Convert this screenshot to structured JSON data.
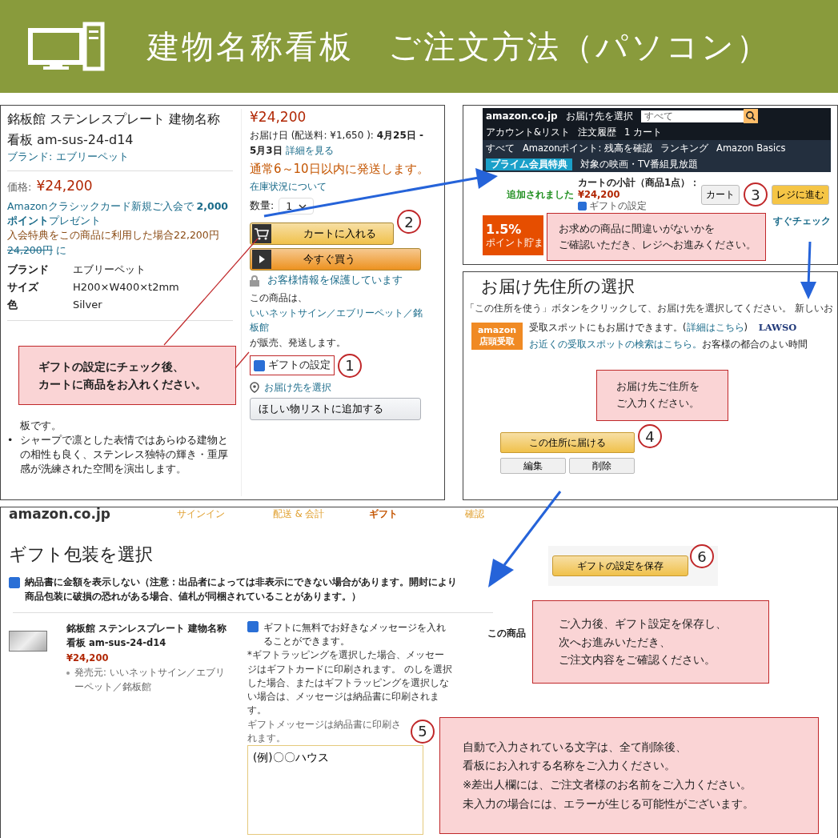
{
  "header": {
    "title": "建物名称看板　ご注文方法（パソコン）"
  },
  "product_panel": {
    "title": "銘板館 ステンレスプレート 建物名称看板 am-sus-24-d14",
    "brand_link": "ブランド: エブリーペット",
    "price_label": "価格:",
    "price": "¥24,200",
    "promo_line": "Amazonクラシックカード新規ご入会で **2,000ポイント**プレゼント",
    "promo_benefit": "入会特典をこの商品に利用した場合22,200円",
    "promo_old_price": "24,200円",
    "promo_suffix": "に",
    "specs": [
      {
        "label": "ブランド",
        "value": "エブリーペット"
      },
      {
        "label": "サイズ",
        "value": "H200×W400×t2mm"
      },
      {
        "label": "色",
        "value": "Silver"
      }
    ],
    "bullets": [
      {
        "kind": "continuation",
        "text": "板です。"
      },
      {
        "kind": "bullet",
        "marker": "•",
        "text": "シャープで凛とした表情ではあらゆる建物との相性も良く、ステンレス独特の輝き・重厚感が洗練された空間を演出します。"
      }
    ],
    "buy_box": {
      "price": "¥24,200",
      "delivery": "お届け日 (配送料: ¥1,650 ): **4月25日 - 5月3日**",
      "details_link": "詳細を見る",
      "shipping_note": "通常6～10日以内に発送します。",
      "stock_link": "在庫状況について",
      "quantity_label": "数量:",
      "quantity": "1",
      "cart_button": "カートに入れる",
      "cart_step": "2",
      "buy_now_button": "今すぐ買う",
      "secure_link": "お客様情報を保護しています",
      "seller_prefix": "この商品は、",
      "seller_link": "いいネットサイン／エブリーペット／銘板館",
      "seller_suffix": "が販売、発送します。",
      "gift_checkbox": {
        "label": "ギフトの設定",
        "checked": true,
        "step": "1"
      },
      "address_link": "お届け先を選択",
      "wishlist_button": "ほしい物リストに追加する"
    },
    "callout": [
      "ギフトの設定にチェック後、",
      "カートに商品をお入れください。"
    ]
  },
  "cart_panel": {
    "logo": "amazon.co.jp",
    "deliver_to": "お届け先を選択",
    "search_scope": "すべて",
    "account": "アカウント&リスト",
    "orders": "注文履歴",
    "cart_link": "カート",
    "cart_count": "1",
    "nav": [
      "すべて",
      "Amazonポイント: 残高を確認",
      "ランキング",
      "Amazon Basics"
    ],
    "prime_banner": "プライム会員特典",
    "video_banner": "対象の映画・TV番組見放題",
    "added": "追加されました",
    "subtotal_label": "カートの小計（商品1点）：",
    "subtotal": "¥24,200",
    "gift_checkbox": {
      "label": "ギフトの設定",
      "checked": true
    },
    "cart_button": "カート",
    "checkout_button": "レジに進む",
    "checkout_step": "3",
    "promo_rate": "1.5%",
    "promo_text": "ポイント貯ま",
    "check_link": "すぐチェック",
    "callout": [
      "お求めの商品に間違いがないかを",
      "ご確認いただき、レジへお進みください。"
    ]
  },
  "address_panel": {
    "title": "お届け先住所の選択",
    "instruction": "「この住所を使う」ボタンをクリックして、お届け先を選択してください。 新しいお",
    "pickup_badge": "amazon 店頭受取",
    "pickup_text": "受取スポットにもお届けできます。(",
    "pickup_link": "詳細はこちら",
    "pickup_close": ")",
    "store_logo": "LAWSO",
    "search_link": "お近くの受取スポットの検索はこちら。",
    "time_text": "お客様の都合のよい時間",
    "callout": [
      "お届け先ご住所を",
      "ご入力ください。"
    ],
    "deliver_button": "この住所に届ける",
    "deliver_step": "4",
    "edit_button": "編集",
    "delete_button": "削除"
  },
  "gift_panel": {
    "logo": "amazon.co.jp",
    "steps": [
      {
        "label": "サインイン",
        "selected": false
      },
      {
        "label": "配送 & 会計",
        "selected": false
      },
      {
        "label": "ギフト",
        "selected": true
      },
      {
        "label": "確認",
        "selected": false
      }
    ],
    "title": "ギフト包装を選択",
    "hide_price": {
      "label": "納品書に金額を表示しない（注意：出品者によっては非表示にできない場合があります。開封により商品包装に破損の恐れがある場合、値札が同梱されていることがあります。）",
      "checked": true
    },
    "item_name": "銘板館 ステンレスプレート 建物名称看板 am-sus-24-d14",
    "item_price": "¥24,200",
    "item_seller": "発売元: いいネットサイン／エブリーペット／銘板館",
    "message_checkbox": {
      "label": "ギフトに無料でお好きなメッセージを入れることができます。",
      "checked": true
    },
    "message_note": "*ギフトラッピングを選択した場合、メッセージはギフトカードに印刷されます。 のしを選択した場合、またはギフトラッピングを選択しない場合は、メッセージは納品書に印刷されます。",
    "message_hint": "ギフトメッセージは納品書に印刷されます。",
    "message_step": "5",
    "message_value": "(例)〇〇ハウス",
    "side_text": "この商品",
    "save_button": "ギフトの設定を保存",
    "save_step": "6",
    "callout_save": [
      "ご入力後、ギフト設定を保存し、",
      "次へお進みいただき、",
      "ご注文内容をご確認ください。"
    ],
    "callout_message": [
      "自動で入力されている文字は、全て削除後、",
      "看板にお入れする名称をご入力ください。",
      "※差出人欄には、ご注文者様のお名前をご入力ください。",
      "未入力の場合には、エラーが生じる可能性がございます。"
    ]
  }
}
